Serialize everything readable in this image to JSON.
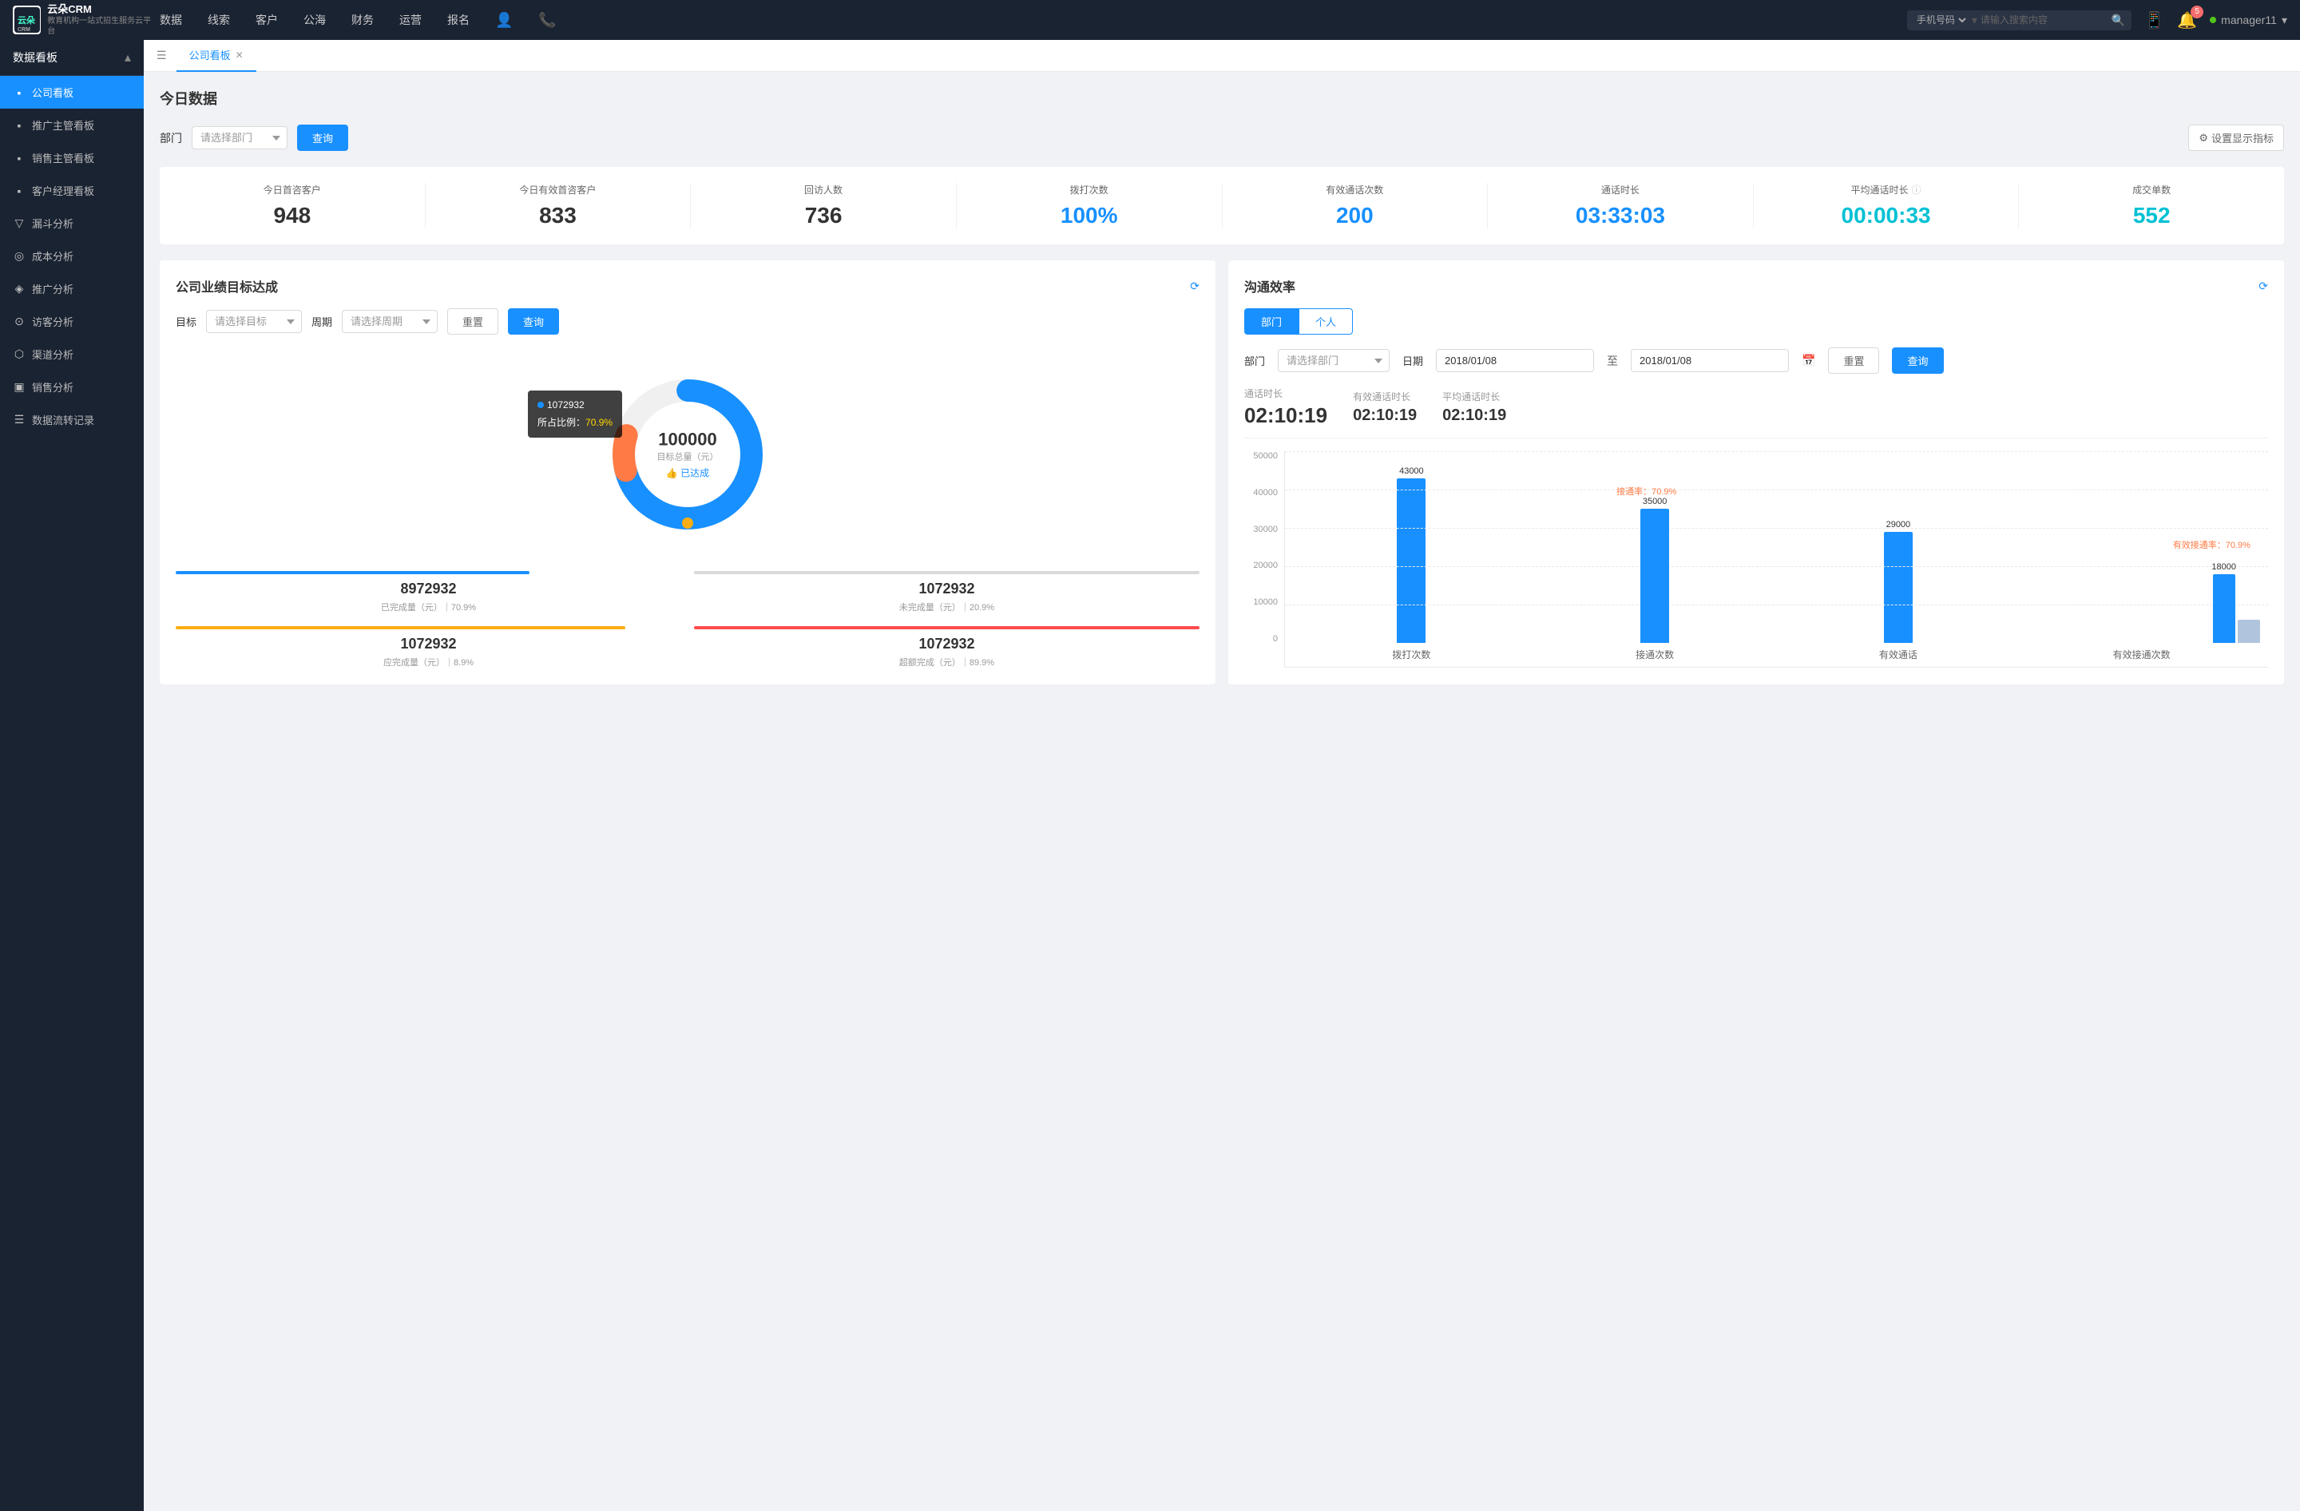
{
  "topNav": {
    "logo": {
      "line1": "云朵CRM",
      "line2": "教育机构一站式\n招生服务云平台"
    },
    "items": [
      "数据",
      "线索",
      "客户",
      "公海",
      "财务",
      "运营",
      "报名"
    ],
    "search": {
      "placeholder": "请输入搜索内容",
      "selectLabel": "手机号码"
    },
    "badge": "5",
    "username": "manager11"
  },
  "sidebar": {
    "title": "数据看板",
    "items": [
      {
        "label": "公司看板",
        "active": true,
        "icon": "📊"
      },
      {
        "label": "推广主管看板",
        "active": false,
        "icon": "📈"
      },
      {
        "label": "销售主管看板",
        "active": false,
        "icon": "💹"
      },
      {
        "label": "客户经理看板",
        "active": false,
        "icon": "👤"
      },
      {
        "label": "漏斗分析",
        "active": false,
        "icon": "▽"
      },
      {
        "label": "成本分析",
        "active": false,
        "icon": "💰"
      },
      {
        "label": "推广分析",
        "active": false,
        "icon": "📡"
      },
      {
        "label": "访客分析",
        "active": false,
        "icon": "🔍"
      },
      {
        "label": "渠道分析",
        "active": false,
        "icon": "🔗"
      },
      {
        "label": "销售分析",
        "active": false,
        "icon": "📉"
      },
      {
        "label": "数据流转记录",
        "active": false,
        "icon": "🗂"
      }
    ]
  },
  "tab": {
    "label": "公司看板",
    "closable": true
  },
  "todayData": {
    "title": "今日数据",
    "filterLabel": "部门",
    "filterPlaceholder": "请选择部门",
    "queryBtn": "查询",
    "settingsBtn": "设置显示指标",
    "stats": [
      {
        "label": "今日首咨客户",
        "value": "948",
        "color": "dark"
      },
      {
        "label": "今日有效首咨客户",
        "value": "833",
        "color": "dark"
      },
      {
        "label": "回访人数",
        "value": "736",
        "color": "dark"
      },
      {
        "label": "拨打次数",
        "value": "100%",
        "color": "blue"
      },
      {
        "label": "有效通话次数",
        "value": "200",
        "color": "blue"
      },
      {
        "label": "通话时长",
        "value": "03:33:03",
        "color": "blue"
      },
      {
        "label": "平均通话时长",
        "value": "00:00:33",
        "color": "cyan"
      },
      {
        "label": "成交单数",
        "value": "552",
        "color": "cyan"
      }
    ]
  },
  "targetSection": {
    "title": "公司业绩目标达成",
    "targetLabel": "目标",
    "targetPlaceholder": "请选择目标",
    "periodLabel": "周期",
    "periodPlaceholder": "请选择周期",
    "resetBtn": "重置",
    "queryBtn": "查询",
    "donut": {
      "centerValue": "100000",
      "centerLabel": "目标总量（元）",
      "centerStatus": "👍 已达成",
      "tooltip": {
        "value": "1072932",
        "pctLabel": "所占比例：",
        "pct": "70.9%"
      },
      "bluePercent": 70.9,
      "orangePercent": 8.9
    },
    "stats": [
      {
        "label": "已完成量（元）｜70.9%",
        "value": "8972932",
        "barColor": "#1890ff",
        "barWidth": "70%"
      },
      {
        "label": "未完成量（元）｜20.9%",
        "value": "1072932",
        "barColor": "#d9d9d9",
        "barWidth": "20.9%"
      },
      {
        "label": "应完成量（元）｜8.9%",
        "value": "1072932",
        "barColor": "#faad14",
        "barWidth": "8.9%"
      },
      {
        "label": "超额完成（元）｜89.9%",
        "value": "1072932",
        "barColor": "#ff4d4f",
        "barWidth": "89.9%"
      }
    ]
  },
  "commSection": {
    "title": "沟通效率",
    "tabs": [
      "部门",
      "个人"
    ],
    "activeTab": "部门",
    "filterLabel": "部门",
    "filterPlaceholder": "请选择部门",
    "dateLabel": "日期",
    "dateFrom": "2018/01/08",
    "dateTo": "2018/01/08",
    "resetBtn": "重置",
    "queryBtn": "查询",
    "stats": [
      {
        "label": "通话时长",
        "value": "02:10:19",
        "large": true
      },
      {
        "label": "有效通话时长",
        "value": "02:10:19",
        "large": false
      },
      {
        "label": "平均通话时长",
        "value": "02:10:19",
        "large": false
      }
    ],
    "chart": {
      "yLabels": [
        "50000",
        "40000",
        "30000",
        "20000",
        "10000",
        "0"
      ],
      "groups": [
        {
          "xLabel": "拨打次数",
          "bars": [
            {
              "value": 43000,
              "label": "43000",
              "color": "#1890ff",
              "heightPct": 86
            }
          ],
          "annotation": ""
        },
        {
          "xLabel": "接通次数",
          "bars": [
            {
              "value": 35000,
              "label": "35000",
              "color": "#1890ff",
              "heightPct": 70
            }
          ],
          "annotation": "接通率：70.9%"
        },
        {
          "xLabel": "有效通话",
          "bars": [
            {
              "value": 29000,
              "label": "29000",
              "color": "#1890ff",
              "heightPct": 58
            }
          ],
          "annotation": ""
        },
        {
          "xLabel": "有效接通次数",
          "bars": [
            {
              "value": 18000,
              "label": "18000",
              "color": "#1890ff",
              "heightPct": 36
            },
            {
              "value": 5000,
              "label": "",
              "color": "#b0c4de",
              "heightPct": 10
            }
          ],
          "annotation": "有效接通率：70.9%"
        }
      ]
    }
  }
}
